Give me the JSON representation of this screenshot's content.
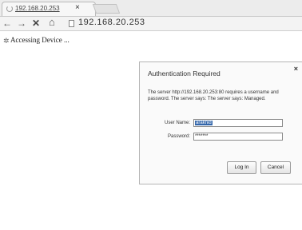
{
  "tab": {
    "title": "192.168.20.253",
    "close_glyph": "×"
  },
  "toolbar": {
    "back_glyph": "←",
    "forward_glyph": "→",
    "stop_glyph": "✕",
    "home_glyph": "⌂",
    "url": "192.168.20.253"
  },
  "page": {
    "loading_text": "Accessing Device ..."
  },
  "auth_dialog": {
    "title": "Authentication Required",
    "close_glyph": "×",
    "message": "The server http://192.168.20.253:80 requires a username and password. The server says: The server says: Managed.",
    "username_label": "User Name:",
    "username_value": "araknid",
    "password_label": "Password:",
    "password_value": "*******",
    "login_label": "Log In",
    "cancel_label": "Cancel"
  }
}
